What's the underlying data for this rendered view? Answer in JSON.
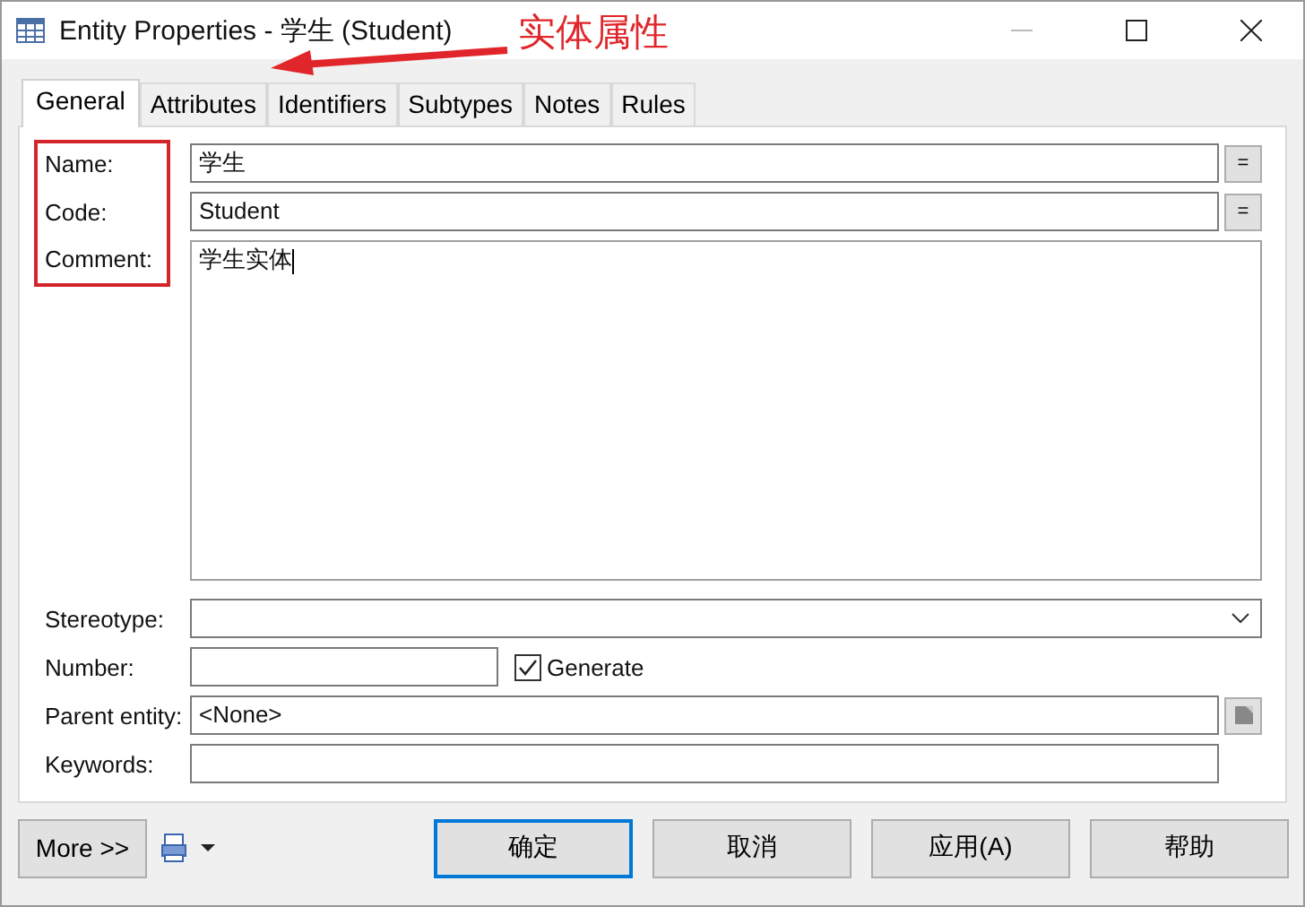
{
  "window": {
    "title": "Entity Properties - 学生 (Student)"
  },
  "annotation": {
    "text": "实体属性"
  },
  "tabs": [
    {
      "label": "General",
      "selected": true
    },
    {
      "label": "Attributes",
      "selected": false
    },
    {
      "label": "Identifiers",
      "selected": false
    },
    {
      "label": "Subtypes",
      "selected": false
    },
    {
      "label": "Notes",
      "selected": false
    },
    {
      "label": "Rules",
      "selected": false
    }
  ],
  "fields": [
    {
      "kind": "text",
      "label": "Name:",
      "value": "学生",
      "button": "="
    },
    {
      "kind": "text",
      "label": "Code:",
      "value": "Student",
      "button": "="
    },
    {
      "kind": "memo",
      "label": "Comment:",
      "value": "学生实体"
    },
    {
      "kind": "dropdown",
      "label": "Stereotype:"
    },
    {
      "kind": "number",
      "label": "Number:",
      "checkbox": {
        "label": "Generate",
        "checked": true
      }
    },
    {
      "kind": "picker",
      "label": "Parent entity:",
      "value": "<None>"
    },
    {
      "kind": "text",
      "label": "Keywords:"
    }
  ],
  "footer": {
    "more": "More >>",
    "buttons": [
      {
        "label": "确定",
        "default": true
      },
      {
        "label": "取消",
        "default": false
      },
      {
        "label": "应用(A)",
        "default": false
      },
      {
        "label": "帮助",
        "default": false
      }
    ]
  }
}
